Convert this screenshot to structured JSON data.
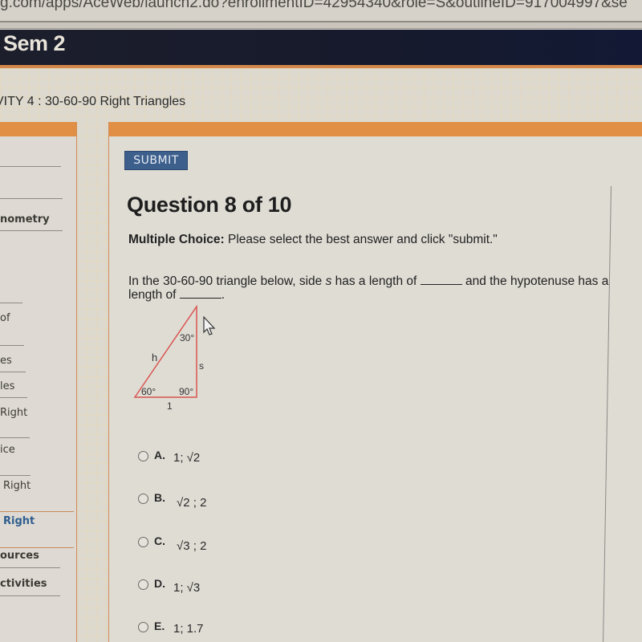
{
  "browser": {
    "url_fragment": "g.com/apps/AceWeb/launch2.do?enrollmentID=42954340&role=S&outlineID=917004997&se"
  },
  "header": {
    "course_title": "Sem 2"
  },
  "activity": {
    "title": "VITY 4 : 30-60-90 Right Triangles"
  },
  "sidebar": {
    "items": [
      {
        "label": "nometry",
        "active": false
      },
      {
        "label": "of",
        "active": false
      },
      {
        "label": "es",
        "active": false
      },
      {
        "label": "les",
        "active": false
      },
      {
        "label": "Right",
        "active": false
      },
      {
        "label": "ice",
        "active": false
      },
      {
        "label": "Right",
        "active": false
      },
      {
        "label": "Right",
        "active": true
      },
      {
        "label": "ources",
        "active": false
      },
      {
        "label": "ctivities",
        "active": false
      }
    ]
  },
  "question": {
    "submit_label": "SUBMIT",
    "title": "Question 8 of 10",
    "instructions_bold": "Multiple Choice:",
    "instructions_text": " Please select the best answer and click \"submit.\"",
    "prompt_part1": "In the 30-60-90 triangle below, side ",
    "prompt_var": "s",
    "prompt_part2": " has a length of ",
    "prompt_part3": " and the hypotenuse has a length of ",
    "prompt_end": ".",
    "figure": {
      "top_angle": "30°",
      "bottom_left_angle": "60°",
      "right_angle": "90°",
      "hyp_label": "h",
      "side_label": "s",
      "base_label": "1",
      "stroke_color": "#d9534f"
    },
    "choices": [
      {
        "letter": "A.",
        "text": "1; √2"
      },
      {
        "letter": "B.",
        "text": "√2 ; 2"
      },
      {
        "letter": "C.",
        "text": "√3 ; 2"
      },
      {
        "letter": "D.",
        "text": "1; √3"
      },
      {
        "letter": "E.",
        "text": "1; 1.7"
      }
    ]
  },
  "colors": {
    "accent_orange": "#e08f45",
    "header_navy": "#161a2c",
    "submit_blue": "#3d5f8c",
    "active_link": "#2f5d8e"
  }
}
